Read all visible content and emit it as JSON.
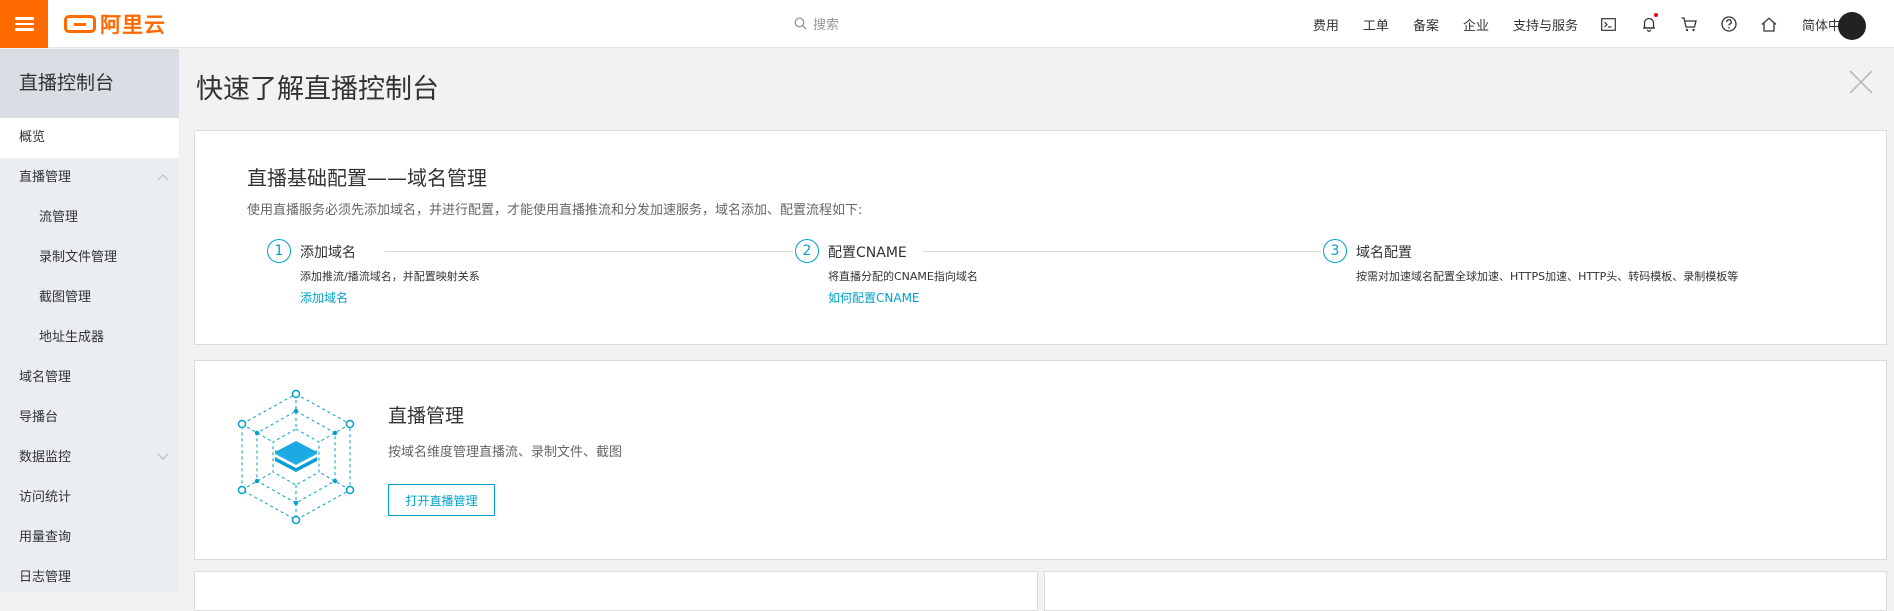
{
  "header": {
    "logo_text": "阿里云",
    "search_placeholder": "搜索",
    "nav_links": [
      "费用",
      "工单",
      "备案",
      "企业",
      "支持与服务"
    ],
    "nav_icons": [
      "terminal-icon",
      "bell-icon",
      "cart-icon",
      "help-icon",
      "home-icon"
    ],
    "language": "简体中文",
    "accent_color": "#ff6a00"
  },
  "sidebar": {
    "title": "直播控制台",
    "items": [
      {
        "label": "概览"
      },
      {
        "label": "直播管理"
      },
      {
        "label": "流管理"
      },
      {
        "label": "录制文件管理"
      },
      {
        "label": "截图管理"
      },
      {
        "label": "地址生成器"
      },
      {
        "label": "域名管理"
      },
      {
        "label": "导播台"
      },
      {
        "label": "数据监控"
      },
      {
        "label": "访问统计"
      },
      {
        "label": "用量查询"
      },
      {
        "label": "日志管理"
      }
    ]
  },
  "main": {
    "page_title": "快速了解直播控制台",
    "domain_card": {
      "title": "直播基础配置——域名管理",
      "description": "使用直播服务必须先添加域名，并进行配置，才能使用直播推流和分发加速服务，域名添加、配置流程如下:",
      "steps": [
        {
          "num": "1",
          "name": "添加域名",
          "desc": "添加推流/播流域名，并配置映射关系",
          "link": "添加域名"
        },
        {
          "num": "2",
          "name": "配置CNAME",
          "desc": "将直播分配的CNAME指向域名",
          "link": "如何配置CNAME"
        },
        {
          "num": "3",
          "name": "域名配置",
          "desc": "按需对加速域名配置全球加速、HTTPS加速、HTTP头、转码模板、录制模板等",
          "link": ""
        }
      ]
    },
    "live_card": {
      "title": "直播管理",
      "description": "按域名维度管理直播流、录制文件、截图",
      "button": "打开直播管理"
    },
    "link_color": "#00a2ca"
  }
}
